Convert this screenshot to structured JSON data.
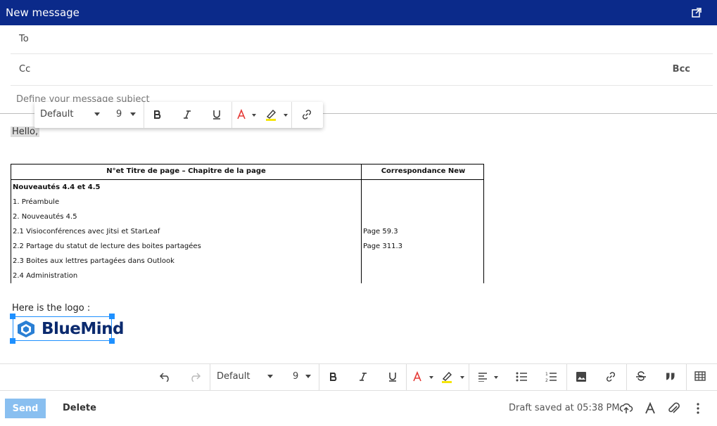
{
  "window": {
    "title": "New message",
    "popout_icon": "external-link-icon"
  },
  "recipients": {
    "to_label": "To",
    "cc_label": "Cc",
    "bcc_label": "Bcc"
  },
  "subject": {
    "placeholder": "Define your message subject"
  },
  "float_toolbar": {
    "font": "Default",
    "size": "9",
    "icons": [
      "bold-icon",
      "italic-icon",
      "underline-icon",
      "text-color-icon",
      "highlight-icon",
      "link-icon"
    ]
  },
  "body": {
    "greeting": "Hello,",
    "table": {
      "headers": [
        "N°et Titre de page – Chapitre de la page",
        "Correspondance New"
      ],
      "rows": [
        {
          "col1": "Nouveautés 4.4 et 4.5",
          "col2": "",
          "bold": true
        },
        {
          "col1": "1. Préambule",
          "col2": ""
        },
        {
          "col1": "2. Nouveautés 4.5",
          "col2": ""
        },
        {
          "col1": "2.1 Visioconférences avec Jitsi et StarLeaf",
          "col2": "Page 59.3"
        },
        {
          "col1": "2.2 Partage du statut de lecture des boites partagées",
          "col2": "Page 311.3"
        },
        {
          "col1": "2.3 Boites aux lettres partagées dans Outlook",
          "col2": ""
        },
        {
          "col1": "2.4 Administration",
          "col2": ""
        }
      ]
    },
    "logo_line": "Here is the logo :",
    "logo_text": "BlueMind"
  },
  "bottom_toolbar": {
    "font": "Default",
    "size": "9",
    "icons": [
      "undo-icon",
      "redo-icon",
      "bold-icon",
      "italic-icon",
      "underline-icon",
      "text-color-icon",
      "highlight-icon",
      "align-icon",
      "bullet-list-icon",
      "numbered-list-icon",
      "image-icon",
      "link-icon",
      "strikethrough-icon",
      "quote-icon",
      "table-icon"
    ]
  },
  "actions": {
    "send_label": "Send",
    "delete_label": "Delete",
    "draft_status": "Draft saved at 05:38 PM"
  },
  "colors": {
    "titlebar": "#0b2a8a",
    "accent": "#1e90ff",
    "send_disabled": "#89bff0",
    "text_color_red": "#e53935",
    "highlight_yellow": "#f5e50a"
  }
}
